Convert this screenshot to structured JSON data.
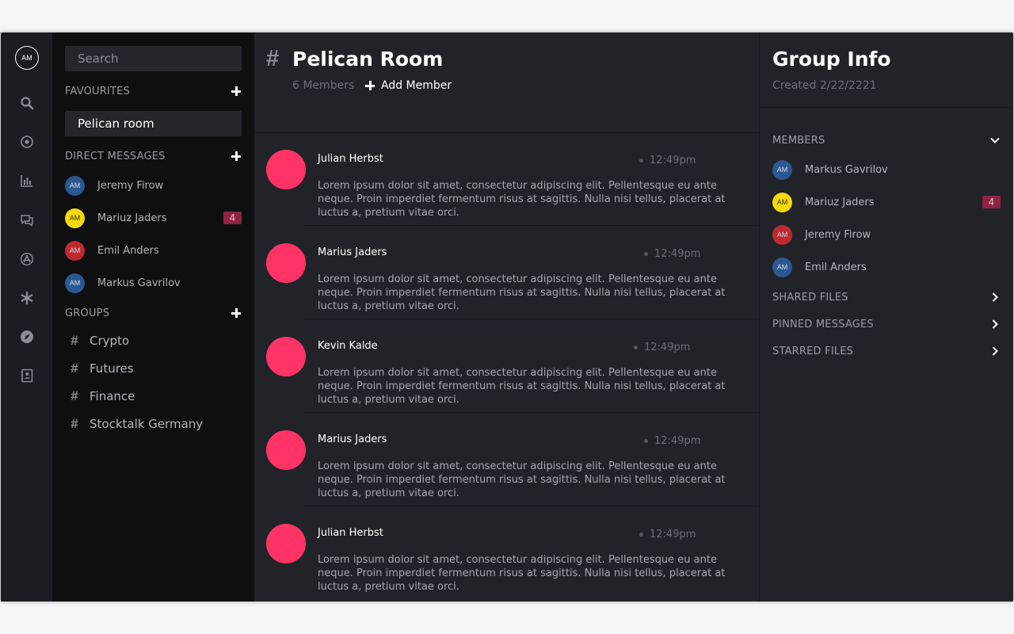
{
  "rail": {
    "avatar_initials": "AM",
    "icons": [
      "search-icon",
      "record-icon",
      "bar-chart-icon",
      "chat-icon",
      "app-store-icon",
      "asterisk-icon",
      "compass-icon",
      "contacts-icon"
    ]
  },
  "sidebar": {
    "search_placeholder": "Search",
    "favourites_title": "FAVOURITES",
    "favourites": [
      {
        "label": "Pelican room"
      }
    ],
    "direct_messages_title": "DIRECT MESSAGES",
    "direct_messages": [
      {
        "initials": "AM",
        "name": "Jeremy Firow",
        "color": "#2b5892",
        "badge": ""
      },
      {
        "initials": "AM",
        "name": "Mariuz Jaders",
        "color": "#f5d90a",
        "badge": "4"
      },
      {
        "initials": "AM",
        "name": "Emil Anders",
        "color": "#c0292f",
        "badge": ""
      },
      {
        "initials": "AM",
        "name": "Markus Gavrilov",
        "color": "#2b5892",
        "badge": ""
      }
    ],
    "groups_title": "GROUPS",
    "groups": [
      {
        "hash": "#",
        "name": "Crypto"
      },
      {
        "hash": "#",
        "name": "Futures"
      },
      {
        "hash": "#",
        "name": "Finance"
      },
      {
        "hash": "#",
        "name": "Stocktalk Germany"
      }
    ]
  },
  "main": {
    "room_hash": "#",
    "room_title": "Pelican Room",
    "members_count": "6 Members",
    "add_member_label": "Add Member",
    "messages": [
      {
        "author": "Julian Herbst",
        "time": "12:49pm",
        "text": "Lorem ipsum dolor sit amet, consectetur adipiscing elit. Pellentesque eu ante neque. Proin imperdiet fermentum risus at sagittis. Nulla nisi tellus, placerat at luctus a, pretium vitae orci."
      },
      {
        "author": "Marius Jaders",
        "time": "12:49pm",
        "text": "Lorem ipsum dolor sit amet, consectetur adipiscing elit. Pellentesque eu ante neque. Proin imperdiet fermentum risus at sagittis. Nulla nisi tellus, placerat at luctus a, pretium vitae orci."
      },
      {
        "author": "Kevin Kalde",
        "time": "12:49pm",
        "text": "Lorem ipsum dolor sit amet, consectetur adipiscing elit. Pellentesque eu ante neque. Proin imperdiet fermentum risus at sagittis. Nulla nisi tellus, placerat at luctus a, pretium vitae orci."
      },
      {
        "author": "Marius Jaders",
        "time": "12:49pm",
        "text": "Lorem ipsum dolor sit amet, consectetur adipiscing elit. Pellentesque eu ante neque. Proin imperdiet fermentum risus at sagittis. Nulla nisi tellus, placerat at luctus a, pretium vitae orci."
      },
      {
        "author": "Julian Herbst",
        "time": "12:49pm",
        "text": "Lorem ipsum dolor sit amet, consectetur adipiscing elit. Pellentesque eu ante neque. Proin imperdiet fermentum risus at sagittis. Nulla nisi tellus, placerat at luctus a, pretium vitae orci."
      }
    ],
    "avatar_color": "#ff3366"
  },
  "info": {
    "title": "Group Info",
    "created": "Created 2/22/2221",
    "members_title": "MEMBERS",
    "members": [
      {
        "initials": "AM",
        "name": "Markus Gavrilov",
        "color": "#2b5892",
        "badge": ""
      },
      {
        "initials": "AM",
        "name": "Mariuz Jaders",
        "color": "#f5d90a",
        "badge": "4"
      },
      {
        "initials": "AM",
        "name": "Jeremy Firow",
        "color": "#c0292f",
        "badge": ""
      },
      {
        "initials": "AM",
        "name": "Emil Anders",
        "color": "#2b5892",
        "badge": ""
      }
    ],
    "shared_files_title": "SHARED FILES",
    "pinned_messages_title": "PINNED MESSAGES",
    "starred_files_title": "STARRED FILES"
  }
}
